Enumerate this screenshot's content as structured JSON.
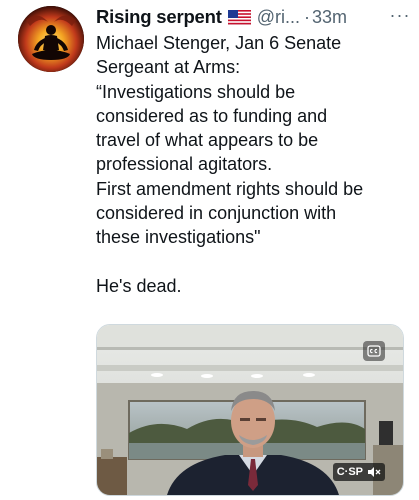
{
  "tweet": {
    "author_name": "Rising serpent",
    "handle": "@ri...",
    "separator": "·",
    "timestamp": "33m",
    "more_label": "···",
    "text_lines": [
      "Michael Stenger, Jan 6 Senate",
      "Sergeant at Arms:",
      "“Investigations should be",
      "considered as to funding and",
      "travel of what appears to be",
      "professional agitators.",
      "First amendment rights should be",
      "considered in conjunction with",
      "these investigations\""
    ],
    "closing_line": "He's dead."
  },
  "media": {
    "logo_text": "C·SP",
    "icons": [
      "closed-captions-icon",
      "muted-speaker-icon"
    ]
  },
  "icons": {
    "avatar": "meditating-figure-avatar",
    "flag": "us-flag-icon",
    "more": "more-options-icon"
  },
  "colors": {
    "text": "#0f1419",
    "secondary": "#536471",
    "avatar_glow": "#f5a623"
  }
}
